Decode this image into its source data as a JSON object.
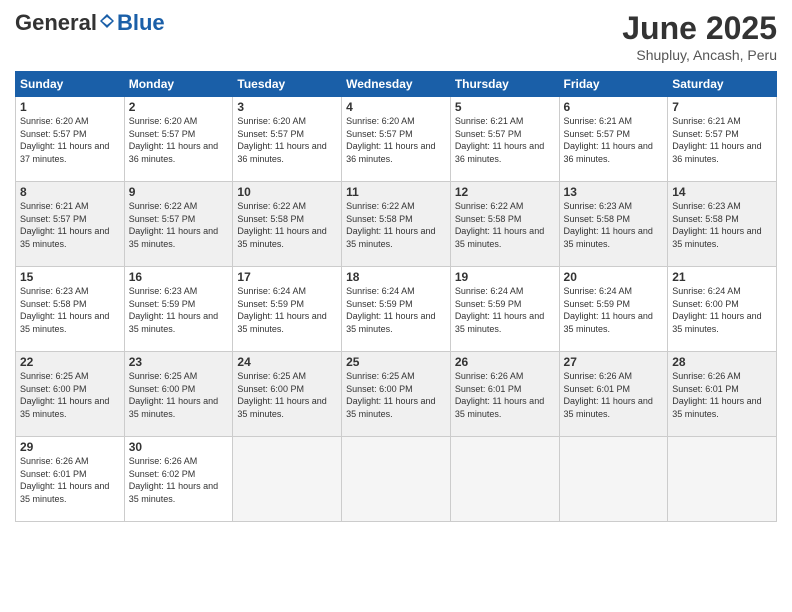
{
  "header": {
    "logo_general": "General",
    "logo_blue": "Blue",
    "month_title": "June 2025",
    "location": "Shupluy, Ancash, Peru"
  },
  "days_of_week": [
    "Sunday",
    "Monday",
    "Tuesday",
    "Wednesday",
    "Thursday",
    "Friday",
    "Saturday"
  ],
  "weeks": [
    {
      "shade": false,
      "days": [
        {
          "num": "1",
          "sunrise": "6:20 AM",
          "sunset": "5:57 PM",
          "daylight": "11 hours and 37 minutes."
        },
        {
          "num": "2",
          "sunrise": "6:20 AM",
          "sunset": "5:57 PM",
          "daylight": "11 hours and 36 minutes."
        },
        {
          "num": "3",
          "sunrise": "6:20 AM",
          "sunset": "5:57 PM",
          "daylight": "11 hours and 36 minutes."
        },
        {
          "num": "4",
          "sunrise": "6:20 AM",
          "sunset": "5:57 PM",
          "daylight": "11 hours and 36 minutes."
        },
        {
          "num": "5",
          "sunrise": "6:21 AM",
          "sunset": "5:57 PM",
          "daylight": "11 hours and 36 minutes."
        },
        {
          "num": "6",
          "sunrise": "6:21 AM",
          "sunset": "5:57 PM",
          "daylight": "11 hours and 36 minutes."
        },
        {
          "num": "7",
          "sunrise": "6:21 AM",
          "sunset": "5:57 PM",
          "daylight": "11 hours and 36 minutes."
        }
      ]
    },
    {
      "shade": true,
      "days": [
        {
          "num": "8",
          "sunrise": "6:21 AM",
          "sunset": "5:57 PM",
          "daylight": "11 hours and 35 minutes."
        },
        {
          "num": "9",
          "sunrise": "6:22 AM",
          "sunset": "5:57 PM",
          "daylight": "11 hours and 35 minutes."
        },
        {
          "num": "10",
          "sunrise": "6:22 AM",
          "sunset": "5:58 PM",
          "daylight": "11 hours and 35 minutes."
        },
        {
          "num": "11",
          "sunrise": "6:22 AM",
          "sunset": "5:58 PM",
          "daylight": "11 hours and 35 minutes."
        },
        {
          "num": "12",
          "sunrise": "6:22 AM",
          "sunset": "5:58 PM",
          "daylight": "11 hours and 35 minutes."
        },
        {
          "num": "13",
          "sunrise": "6:23 AM",
          "sunset": "5:58 PM",
          "daylight": "11 hours and 35 minutes."
        },
        {
          "num": "14",
          "sunrise": "6:23 AM",
          "sunset": "5:58 PM",
          "daylight": "11 hours and 35 minutes."
        }
      ]
    },
    {
      "shade": false,
      "days": [
        {
          "num": "15",
          "sunrise": "6:23 AM",
          "sunset": "5:58 PM",
          "daylight": "11 hours and 35 minutes."
        },
        {
          "num": "16",
          "sunrise": "6:23 AM",
          "sunset": "5:59 PM",
          "daylight": "11 hours and 35 minutes."
        },
        {
          "num": "17",
          "sunrise": "6:24 AM",
          "sunset": "5:59 PM",
          "daylight": "11 hours and 35 minutes."
        },
        {
          "num": "18",
          "sunrise": "6:24 AM",
          "sunset": "5:59 PM",
          "daylight": "11 hours and 35 minutes."
        },
        {
          "num": "19",
          "sunrise": "6:24 AM",
          "sunset": "5:59 PM",
          "daylight": "11 hours and 35 minutes."
        },
        {
          "num": "20",
          "sunrise": "6:24 AM",
          "sunset": "5:59 PM",
          "daylight": "11 hours and 35 minutes."
        },
        {
          "num": "21",
          "sunrise": "6:24 AM",
          "sunset": "6:00 PM",
          "daylight": "11 hours and 35 minutes."
        }
      ]
    },
    {
      "shade": true,
      "days": [
        {
          "num": "22",
          "sunrise": "6:25 AM",
          "sunset": "6:00 PM",
          "daylight": "11 hours and 35 minutes."
        },
        {
          "num": "23",
          "sunrise": "6:25 AM",
          "sunset": "6:00 PM",
          "daylight": "11 hours and 35 minutes."
        },
        {
          "num": "24",
          "sunrise": "6:25 AM",
          "sunset": "6:00 PM",
          "daylight": "11 hours and 35 minutes."
        },
        {
          "num": "25",
          "sunrise": "6:25 AM",
          "sunset": "6:00 PM",
          "daylight": "11 hours and 35 minutes."
        },
        {
          "num": "26",
          "sunrise": "6:26 AM",
          "sunset": "6:01 PM",
          "daylight": "11 hours and 35 minutes."
        },
        {
          "num": "27",
          "sunrise": "6:26 AM",
          "sunset": "6:01 PM",
          "daylight": "11 hours and 35 minutes."
        },
        {
          "num": "28",
          "sunrise": "6:26 AM",
          "sunset": "6:01 PM",
          "daylight": "11 hours and 35 minutes."
        }
      ]
    },
    {
      "shade": false,
      "days": [
        {
          "num": "29",
          "sunrise": "6:26 AM",
          "sunset": "6:01 PM",
          "daylight": "11 hours and 35 minutes."
        },
        {
          "num": "30",
          "sunrise": "6:26 AM",
          "sunset": "6:02 PM",
          "daylight": "11 hours and 35 minutes."
        },
        null,
        null,
        null,
        null,
        null
      ]
    }
  ]
}
